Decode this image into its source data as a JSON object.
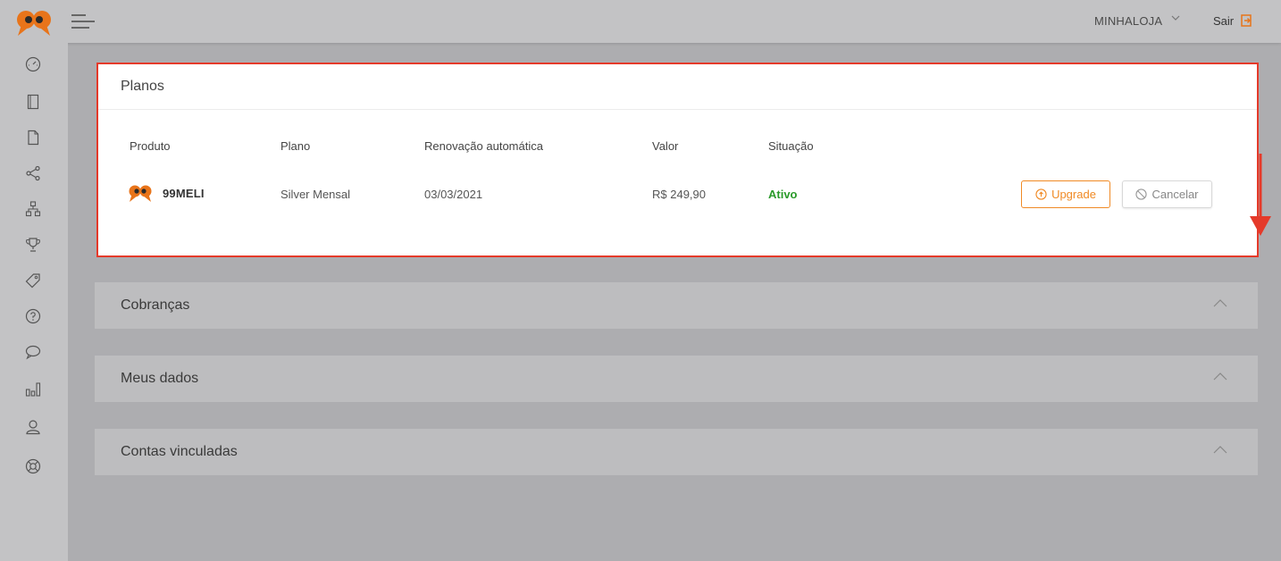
{
  "header": {
    "store_name": "MINHALOJA",
    "logout_label": "Sair",
    "brand_color": "#f08a25"
  },
  "sidebar": {
    "icons": [
      "dashboard-icon",
      "notebook-icon",
      "document-icon",
      "share-icon",
      "sitemap-icon",
      "trophy-icon",
      "tag-icon",
      "help-icon",
      "chat-icon",
      "bar-chart-icon",
      "user-icon",
      "support-icon"
    ]
  },
  "planos": {
    "title": "Planos",
    "columns": [
      "Produto",
      "Plano",
      "Renovação automática",
      "Valor",
      "Situação"
    ],
    "row": {
      "product": "99MELI",
      "plan": "Silver Mensal",
      "renewal": "03/03/2021",
      "value": "R$ 249,90",
      "status": "Ativo"
    },
    "upgrade_label": "Upgrade",
    "cancel_label": "Cancelar"
  },
  "panels": [
    {
      "title": "Cobranças"
    },
    {
      "title": "Meus dados"
    },
    {
      "title": "Contas vinculadas"
    }
  ]
}
